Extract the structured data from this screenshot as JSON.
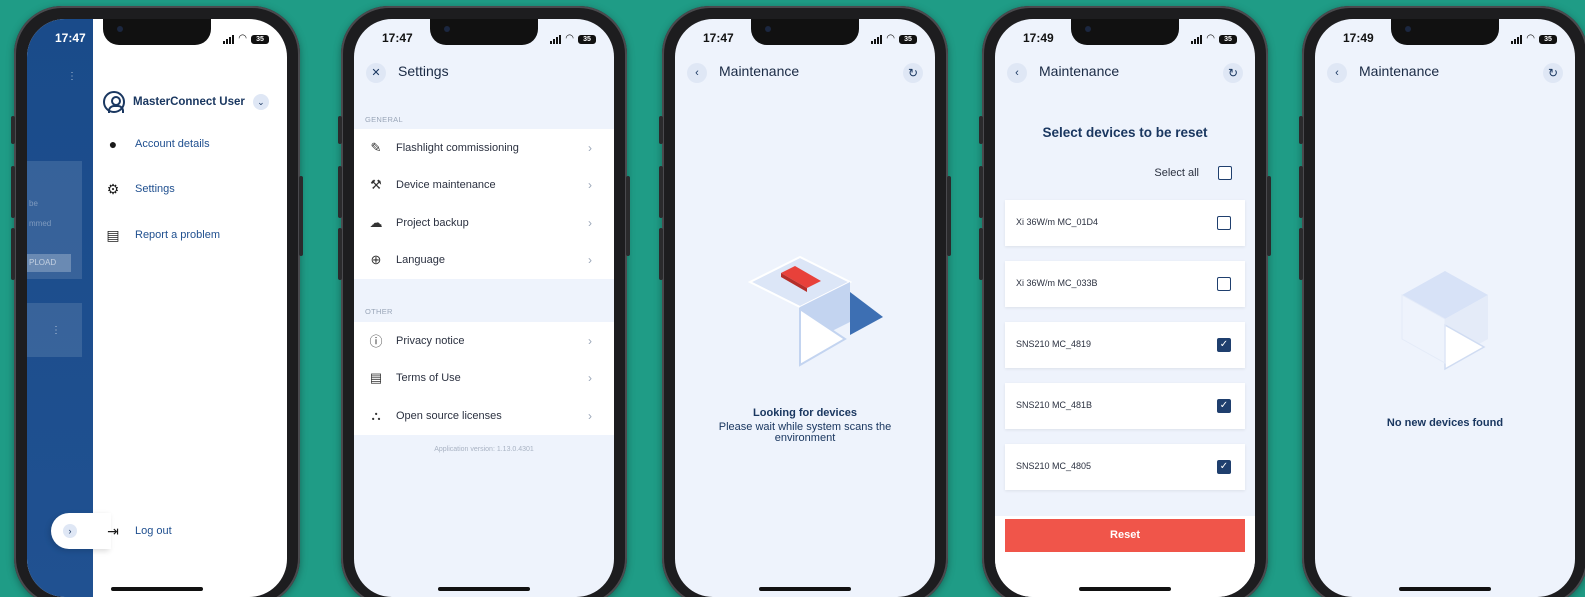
{
  "screen1": {
    "time": "17:47",
    "battery": "35",
    "bg_text_1": "be",
    "bg_text_2": "mmed",
    "bg_button": "PLOAD",
    "user_name": "MasterConnect User",
    "menu": [
      {
        "label": "Account details",
        "icon": "account-circle-icon"
      },
      {
        "label": "Settings",
        "icon": "gear-icon"
      },
      {
        "label": "Report a problem",
        "icon": "feedback-icon"
      }
    ],
    "logout": "Log out"
  },
  "screen2": {
    "time": "17:47",
    "battery": "35",
    "title": "Settings",
    "section_general": "GENERAL",
    "general_items": [
      {
        "label": "Flashlight commissioning",
        "icon": "flashlight-icon"
      },
      {
        "label": "Device maintenance",
        "icon": "wrench-icon"
      },
      {
        "label": "Project backup",
        "icon": "cloud-upload-icon"
      },
      {
        "label": "Language",
        "icon": "globe-icon"
      }
    ],
    "section_other": "OTHER",
    "other_items": [
      {
        "label": "Privacy notice",
        "icon": "info-icon"
      },
      {
        "label": "Terms of Use",
        "icon": "document-icon"
      },
      {
        "label": "Open source licenses",
        "icon": "shapes-icon"
      }
    ],
    "version": "Application version: 1.13.0.4301"
  },
  "screen3": {
    "time": "17:47",
    "battery": "35",
    "title": "Maintenance",
    "message_title": "Looking for devices",
    "message_body": "Please wait while system scans the environment"
  },
  "screen4": {
    "time": "17:49",
    "battery": "35",
    "title": "Maintenance",
    "heading": "Select devices to be reset",
    "select_all": "Select all",
    "devices": [
      {
        "name": "Xi 36W/m MC_01D4",
        "checked": false
      },
      {
        "name": "Xi 36W/m MC_033B",
        "checked": false
      },
      {
        "name": "SNS210 MC_4819",
        "checked": true
      },
      {
        "name": "SNS210 MC_481B",
        "checked": true
      },
      {
        "name": "SNS210 MC_4805",
        "checked": true
      }
    ],
    "reset_label": "Reset",
    "accent": "#f0554a"
  },
  "screen5": {
    "time": "17:49",
    "battery": "35",
    "title": "Maintenance",
    "message": "No new devices found"
  },
  "colors": {
    "background": "#1f9c86",
    "primary": "#1a3760",
    "link": "#1f4f8f",
    "drawer": "#1a4b8a"
  }
}
